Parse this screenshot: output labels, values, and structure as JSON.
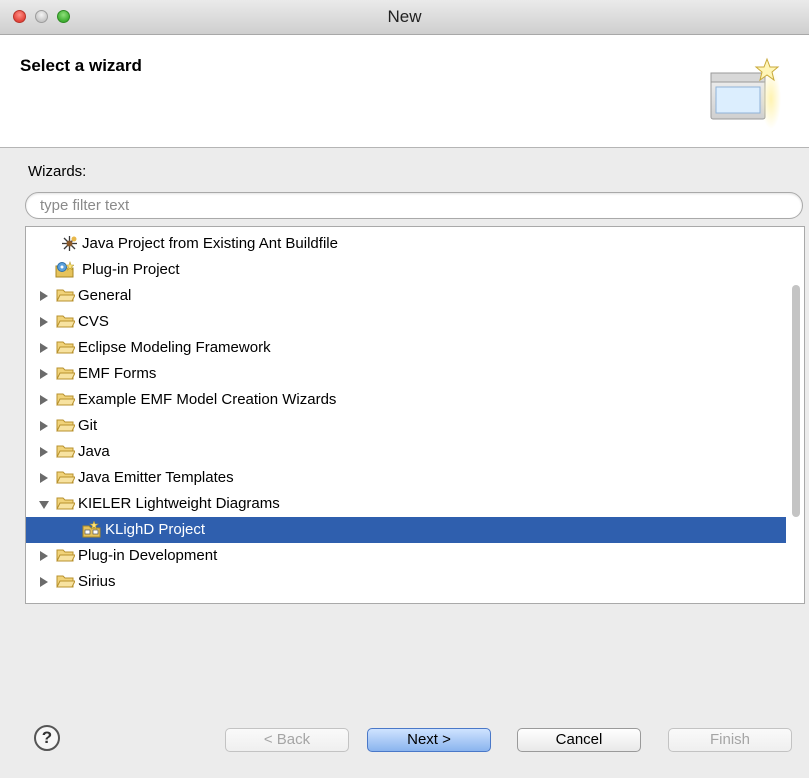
{
  "window": {
    "title": "New"
  },
  "header": {
    "title": "Select a wizard"
  },
  "wizards": {
    "label": "Wizards:"
  },
  "filter": {
    "placeholder": "type filter text",
    "value": ""
  },
  "tree": {
    "rows": [
      {
        "label": "Java Project from Existing Ant Buildfile",
        "icon": "ant-icon"
      },
      {
        "label": "Plug-in Project",
        "icon": "plugin-project-icon"
      },
      {
        "label": "General",
        "icon": "folder-icon"
      },
      {
        "label": "CVS",
        "icon": "folder-icon"
      },
      {
        "label": "Eclipse Modeling Framework",
        "icon": "folder-icon"
      },
      {
        "label": "EMF Forms",
        "icon": "folder-icon"
      },
      {
        "label": "Example EMF Model Creation Wizards",
        "icon": "folder-icon"
      },
      {
        "label": "Git",
        "icon": "folder-icon"
      },
      {
        "label": "Java",
        "icon": "folder-icon"
      },
      {
        "label": "Java Emitter Templates",
        "icon": "folder-icon"
      },
      {
        "label": "KIELER Lightweight Diagrams",
        "icon": "folder-icon",
        "expanded": true
      },
      {
        "label": "KLighD Project",
        "icon": "klighd-project-icon",
        "selected": true
      },
      {
        "label": "Plug-in Development",
        "icon": "folder-icon"
      },
      {
        "label": "Sirius",
        "icon": "folder-icon"
      }
    ]
  },
  "buttons": {
    "help": "?",
    "back": "< Back",
    "next": "Next >",
    "cancel": "Cancel",
    "finish": "Finish"
  },
  "colors": {
    "selection": "#2f5fae",
    "accent": "#8ab4ee"
  }
}
